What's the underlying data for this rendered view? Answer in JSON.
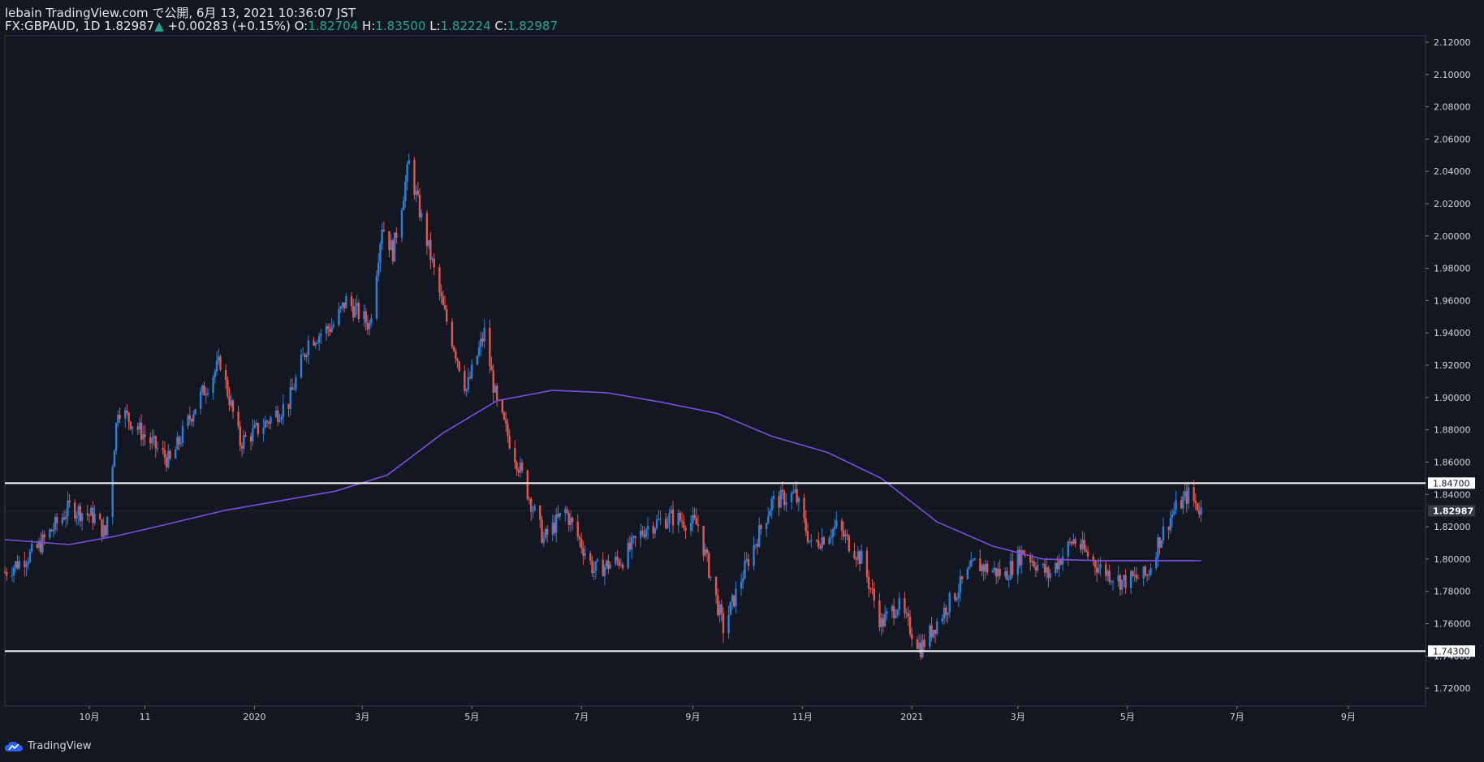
{
  "header": {
    "line1": "lebain TradingView.com で公開, 6月 13, 2021 10:36:07 JST",
    "symbol": "FX:GBPAUD, 1D",
    "last": "1.82987",
    "change": "+0.00283 (+0.15%)",
    "o_label": "O:",
    "o_val": "1.82704",
    "h_label": "H:",
    "h_val": "1.83500",
    "l_label": "L:",
    "l_val": "1.82224",
    "c_label": "C:",
    "c_val": "1.82987"
  },
  "footer": {
    "brand": "TradingView",
    "logo_icon": "tradingview-cloud-icon"
  },
  "colors": {
    "background": "#131722",
    "up": "#2f7fd6",
    "down": "#e0574f",
    "ma": "#7c4dde",
    "line": "#ffffff",
    "text": "#d1d4dc",
    "accent_green": "#26a69a"
  },
  "chart_data": {
    "type": "candlestick",
    "symbol": "FX:GBPAUD",
    "interval": "1D",
    "x_tick_labels": [
      "10月",
      "11",
      "2020",
      "3月",
      "5月",
      "7月",
      "9月",
      "11月",
      "2021",
      "3月",
      "5月",
      "7月",
      "9月"
    ],
    "y_tick_labels": [
      "2.12000",
      "2.10000",
      "2.08000",
      "2.06000",
      "2.04000",
      "2.02000",
      "2.00000",
      "1.98000",
      "1.96000",
      "1.94000",
      "1.92000",
      "1.90000",
      "1.88000",
      "1.86000",
      "1.84000",
      "1.82000",
      "1.80000",
      "1.78000",
      "1.76000",
      "1.74000",
      "1.72000"
    ],
    "ylim": [
      1.709,
      2.124
    ],
    "current_price": 1.82987,
    "horizontal_lines": [
      {
        "price": 1.847,
        "label": "1.84700"
      },
      {
        "price": 1.743,
        "label": "1.74300"
      }
    ],
    "last_price_label": "1.82987",
    "price_path": [
      [
        "2019-08-15",
        1.792
      ],
      [
        "2019-09-01",
        1.805
      ],
      [
        "2019-09-20",
        1.832
      ],
      [
        "2019-10-04",
        1.826
      ],
      [
        "2019-10-10",
        1.815
      ],
      [
        "2019-10-17",
        1.894
      ],
      [
        "2019-11-01",
        1.876
      ],
      [
        "2019-11-15",
        1.86
      ],
      [
        "2019-11-29",
        1.895
      ],
      [
        "2019-12-13",
        1.922
      ],
      [
        "2019-12-24",
        1.872
      ],
      [
        "2020-01-06",
        1.883
      ],
      [
        "2020-01-20",
        1.897
      ],
      [
        "2020-01-31",
        1.935
      ],
      [
        "2020-02-14",
        1.945
      ],
      [
        "2020-02-21",
        1.96
      ],
      [
        "2020-03-05",
        1.945
      ],
      [
        "2020-03-12",
        2.007
      ],
      [
        "2020-03-18",
        1.99
      ],
      [
        "2020-03-27",
        2.045
      ],
      [
        "2020-04-01",
        2.02
      ],
      [
        "2020-04-15",
        1.955
      ],
      [
        "2020-04-28",
        1.905
      ],
      [
        "2020-05-08",
        1.94
      ],
      [
        "2020-05-15",
        1.895
      ],
      [
        "2020-05-28",
        1.855
      ],
      [
        "2020-06-10",
        1.812
      ],
      [
        "2020-06-22",
        1.83
      ],
      [
        "2020-07-08",
        1.793
      ],
      [
        "2020-07-24",
        1.8
      ],
      [
        "2020-08-06",
        1.82
      ],
      [
        "2020-08-20",
        1.826
      ],
      [
        "2020-09-04",
        1.821
      ],
      [
        "2020-09-18",
        1.757
      ],
      [
        "2020-10-02",
        1.8
      ],
      [
        "2020-10-15",
        1.835
      ],
      [
        "2020-10-28",
        1.84
      ],
      [
        "2020-11-06",
        1.808
      ],
      [
        "2020-11-20",
        1.82
      ],
      [
        "2020-12-04",
        1.8
      ],
      [
        "2020-12-15",
        1.76
      ],
      [
        "2020-12-24",
        1.772
      ],
      [
        "2021-01-01",
        1.755
      ],
      [
        "2021-01-06",
        1.745
      ],
      [
        "2021-01-20",
        1.77
      ],
      [
        "2021-02-05",
        1.797
      ],
      [
        "2021-02-22",
        1.79
      ],
      [
        "2021-03-04",
        1.805
      ],
      [
        "2021-03-18",
        1.79
      ],
      [
        "2021-04-01",
        1.812
      ],
      [
        "2021-04-15",
        1.795
      ],
      [
        "2021-04-28",
        1.786
      ],
      [
        "2021-05-12",
        1.79
      ],
      [
        "2021-05-18",
        1.81
      ],
      [
        "2021-05-27",
        1.83
      ],
      [
        "2021-06-04",
        1.84
      ],
      [
        "2021-06-11",
        1.83
      ]
    ],
    "moving_average": [
      [
        "2019-08-15",
        1.812
      ],
      [
        "2019-09-20",
        1.809
      ],
      [
        "2019-10-15",
        1.814
      ],
      [
        "2019-11-15",
        1.822
      ],
      [
        "2019-12-15",
        1.83
      ],
      [
        "2020-01-15",
        1.836
      ],
      [
        "2020-02-15",
        1.842
      ],
      [
        "2020-03-15",
        1.852
      ],
      [
        "2020-04-15",
        1.878
      ],
      [
        "2020-05-15",
        1.898
      ],
      [
        "2020-06-15",
        1.9045
      ],
      [
        "2020-07-15",
        1.903
      ],
      [
        "2020-08-15",
        1.897
      ],
      [
        "2020-09-15",
        1.89
      ],
      [
        "2020-10-15",
        1.876
      ],
      [
        "2020-11-15",
        1.866
      ],
      [
        "2020-12-15",
        1.85
      ],
      [
        "2021-01-15",
        1.823
      ],
      [
        "2021-02-15",
        1.808
      ],
      [
        "2021-03-15",
        1.8
      ],
      [
        "2021-04-15",
        1.799
      ],
      [
        "2021-05-15",
        1.799
      ],
      [
        "2021-06-11",
        1.799
      ]
    ]
  }
}
